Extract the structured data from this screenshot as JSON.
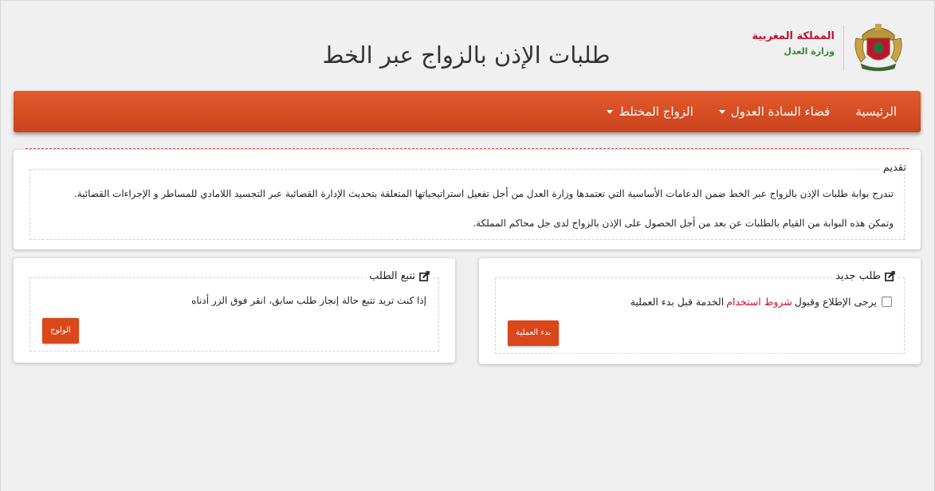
{
  "header": {
    "title": "طلبات الإذن بالزواج عبر الخط",
    "kingdom": "المملكة المغربية",
    "ministry": "وزارة العدل",
    "emblem_icon": "moroccan-coat-of-arms-emblem"
  },
  "nav": {
    "home": "الرئيسية",
    "adouls": "فضاء السادة العدول",
    "mixed": "الزواج المختلط"
  },
  "intro": {
    "legend": "تقديم",
    "paragraph1": "تندرج بوابة طلبات الإذن بالزواج عبر الخط ضمن الدعامات الأساسية التي تعتمدها وزارة العدل من أجل تفعيل استراتيجياتها المتعلقة بتحديث الإدارة القضائية عبر التجسيد اللامادي للمساطر و الإجراءات القضائية.",
    "paragraph2": "وتمكن هذه البوابة من القيام بالطلبات عن بعد من أجل الحصول على الإذن بالزواج لدى جل محاكم المملكة."
  },
  "new_request": {
    "legend": "طلب جديد",
    "consent_prefix": "يرجى الإطلاع وقبول",
    "terms_link": "شروط استخدام",
    "consent_suffix": "الخدمة قبل بدء العملية",
    "button": "بدء العملية",
    "icon": "edit-icon"
  },
  "track_request": {
    "legend": "تتبع الطلب",
    "text": "إذا كنت تريد تتبع حالة إنجاز طلب سابق، انقر فوق الزر أدناه",
    "button": "الولوج",
    "icon": "edit-icon"
  },
  "colors": {
    "navbar": "#d9471b",
    "button": "#d9471b",
    "kingdom_red": "#c8102e",
    "ministry_green": "#2e8b2e"
  }
}
